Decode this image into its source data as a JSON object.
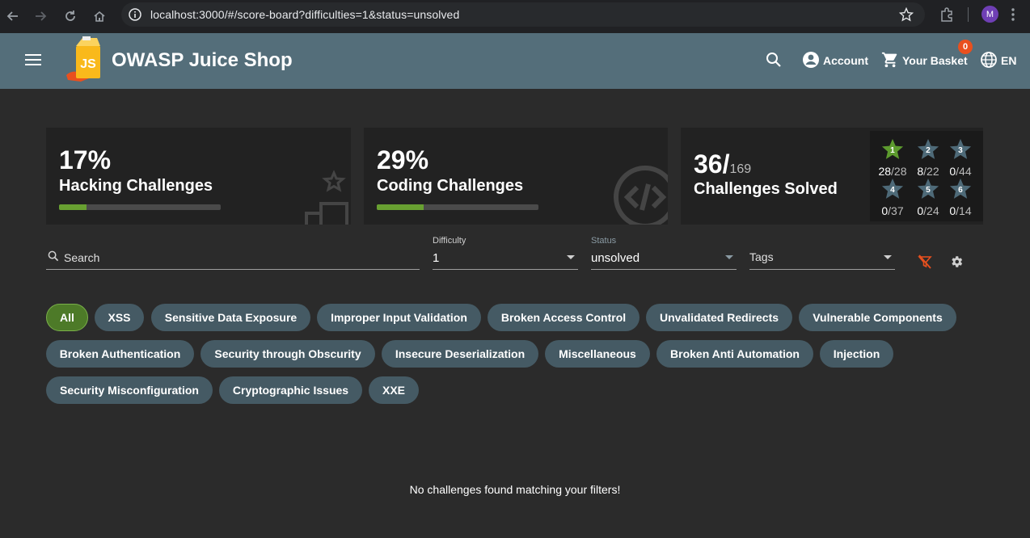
{
  "browser": {
    "url": "localhost:3000/#/score-board?difficulties=1&status=unsolved",
    "profile_initial": "M"
  },
  "app": {
    "title": "OWASP Juice Shop",
    "account_label": "Account",
    "basket_label": "Your Basket",
    "basket_count": "0",
    "language": "EN",
    "accent_color": "#546e7a"
  },
  "cards": {
    "hacking": {
      "percent": "17%",
      "label": "Hacking Challenges",
      "progress": 0.17
    },
    "coding": {
      "percent": "29%",
      "label": "Coding Challenges",
      "progress": 0.29
    },
    "solved": {
      "count": "36/",
      "total": "169",
      "label": "Challenges Solved",
      "stars": [
        {
          "level": "1",
          "solved": "28",
          "total": "/28",
          "complete": true
        },
        {
          "level": "2",
          "solved": "8",
          "total": "/22",
          "complete": false
        },
        {
          "level": "3",
          "solved": "0",
          "total": "/44",
          "complete": false
        },
        {
          "level": "4",
          "solved": "0",
          "total": "/37",
          "complete": false
        },
        {
          "level": "5",
          "solved": "0",
          "total": "/24",
          "complete": false
        },
        {
          "level": "6",
          "solved": "0",
          "total": "/14",
          "complete": false
        }
      ]
    }
  },
  "filters": {
    "search_placeholder": "Search",
    "difficulty_label": "Difficulty",
    "difficulty_value": "1",
    "status_label": "Status",
    "status_value": "unsolved",
    "tags_placeholder": "Tags"
  },
  "categories": [
    "All",
    "XSS",
    "Sensitive Data Exposure",
    "Improper Input Validation",
    "Broken Access Control",
    "Unvalidated Redirects",
    "Vulnerable Components",
    "Broken Authentication",
    "Security through Obscurity",
    "Insecure Deserialization",
    "Miscellaneous",
    "Broken Anti Automation",
    "Injection",
    "Security Misconfiguration",
    "Cryptographic Issues",
    "XXE"
  ],
  "empty_message": "No challenges found matching your filters!"
}
